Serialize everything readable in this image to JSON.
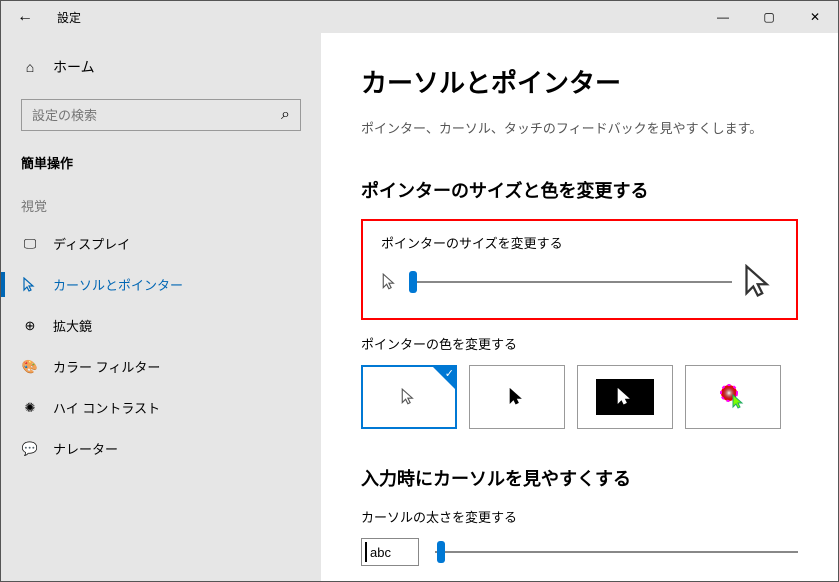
{
  "titlebar": {
    "title": "設定"
  },
  "sidebar": {
    "home": "ホーム",
    "search_placeholder": "設定の検索",
    "category": "簡単操作",
    "group": "視覚",
    "items": [
      {
        "label": "ディスプレイ"
      },
      {
        "label": "カーソルとポインター"
      },
      {
        "label": "拡大鏡"
      },
      {
        "label": "カラー フィルター"
      },
      {
        "label": "ハイ コントラスト"
      },
      {
        "label": "ナレーター"
      }
    ]
  },
  "main": {
    "heading": "カーソルとポインター",
    "desc": "ポインター、カーソル、タッチのフィードバックを見やすくします。",
    "section1": "ポインターのサイズと色を変更する",
    "size_label": "ポインターのサイズを変更する",
    "color_label": "ポインターの色を変更する",
    "section2": "入力時にカーソルを見やすくする",
    "thick_label": "カーソルの太さを変更する",
    "abc": "abc"
  }
}
